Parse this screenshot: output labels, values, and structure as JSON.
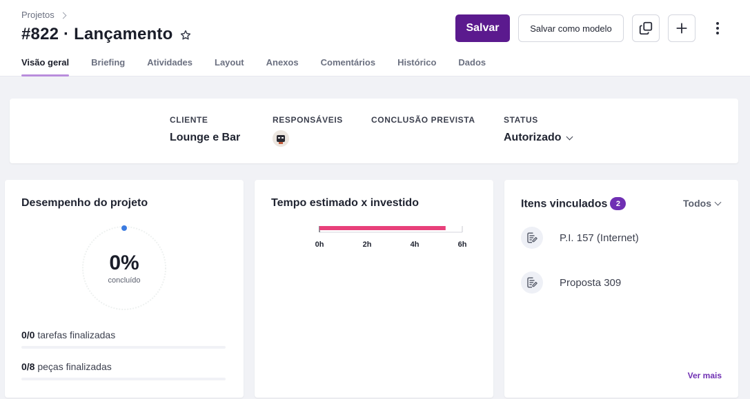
{
  "header": {
    "breadcrumb": "Projetos",
    "title": "#822 · Lançamento",
    "save_label": "Salvar",
    "save_template_label": "Salvar como modelo",
    "primary_color": "#5b1a8e"
  },
  "tabs": [
    {
      "label": "Visão geral",
      "active": true
    },
    {
      "label": "Briefing"
    },
    {
      "label": "Atividades"
    },
    {
      "label": "Layout"
    },
    {
      "label": "Anexos"
    },
    {
      "label": "Comentários"
    },
    {
      "label": "Histórico"
    },
    {
      "label": "Dados"
    }
  ],
  "info": {
    "client_label": "CLIENTE",
    "client_value": "Lounge e Bar",
    "responsibles_label": "RESPONSÁVEIS",
    "completion_label": "CONCLUSÃO PREVISTA",
    "status_label": "STATUS",
    "status_value": "Autorizado"
  },
  "performance": {
    "title": "Desempenho do projeto",
    "percent": "0%",
    "percent_label": "concluído",
    "progress": 0,
    "tasks_count": "0/0",
    "tasks_label": "tarefas finalizadas",
    "pieces_count": "0/8",
    "pieces_label": "peças finalizadas"
  },
  "time": {
    "title": "Tempo estimado x investido",
    "ticks": [
      "0h",
      "2h",
      "4h",
      "6h"
    ],
    "bar_color": "#e8407a"
  },
  "chart_data": {
    "type": "bar",
    "title": "Tempo estimado x investido",
    "categories": [
      ""
    ],
    "values": [
      5.3
    ],
    "xlim": [
      0,
      6
    ],
    "xticks": [
      "0h",
      "2h",
      "4h",
      "6h"
    ]
  },
  "linked": {
    "title": "Itens vinculados",
    "count": "2",
    "filter": "Todos",
    "items": [
      {
        "label": "P.I. 157 (Internet)",
        "icon": "document-edit-icon"
      },
      {
        "label": "Proposta 309",
        "icon": "document-edit-icon"
      }
    ],
    "see_more": "Ver mais"
  }
}
